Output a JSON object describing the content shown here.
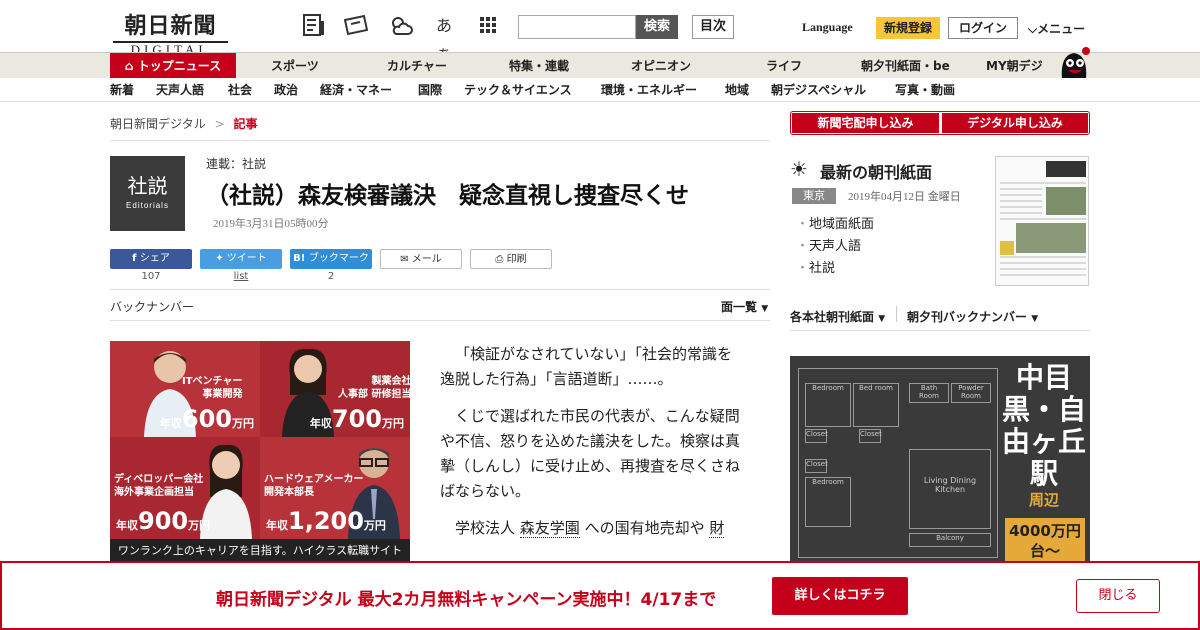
{
  "header": {
    "logo_jp": "朝日新聞",
    "logo_en": "DIGITAL",
    "font_size_icon_label": "あぁ",
    "search_button": "検索",
    "mokuji": "目次",
    "language": "Language",
    "register": "新規登録",
    "login": "ログイン",
    "menu": "メニュー"
  },
  "nav1": [
    "トップニュース",
    "スポーツ",
    "カルチャー",
    "特集・連載",
    "オピニオン",
    "ライフ",
    "朝夕刊紙面・be",
    "MY朝デジ"
  ],
  "nav2": [
    "新着",
    "天声人語",
    "社会",
    "政治",
    "経済・マネー",
    "国際",
    "テック＆サイエンス",
    "環境・エネルギー",
    "地域",
    "朝デジスペシャル",
    "写真・動画"
  ],
  "breadcrumb": {
    "home": "朝日新聞デジタル",
    "sep": ">",
    "current": "記事"
  },
  "article": {
    "category_box_jp": "社説",
    "category_box_en": "Editorials",
    "series": "連載：社説",
    "title": "（社説）森友検審議決　疑念直視し捜査尽くせ",
    "date": "2019年3月31日05時00分",
    "share": {
      "label": "シェア",
      "count": "107"
    },
    "tweet": {
      "label": "ツイート",
      "count": "list"
    },
    "bookmark": {
      "label": "ブックマーク",
      "count": "2"
    },
    "mail": "メール",
    "print": "印刷",
    "back_number": "バックナンバー",
    "ichiran": "面一覧",
    "p1": "「検証がなされていない」「社会的常識を逸脱した行為」「言語道断」……。",
    "p2": "くじで選ばれた市民の代表が、こんな疑問や不信、怒りを込めた議決をした。検察は真摯（しんし）に受け止め、再捜査を尽くさねばならない。",
    "p3_a": "学校法人",
    "p3_link": "森友学園",
    "p3_b": "への国有地売却や",
    "p3_c": "財"
  },
  "ad1": {
    "q1_title": "ITベンチャー\n事業開発",
    "q1_sal_pre": "年収",
    "q1_sal": "600",
    "q2_title": "製薬会社\n人事部 研修担当",
    "q2_sal_pre": "年収",
    "q2_sal": "700",
    "q3_title": "ディベロッパー会社\n海外事業企画担当",
    "q3_sal_pre": "年収",
    "q3_sal": "900",
    "q4_title": "ハードウェアメーカー\n開発本部長",
    "q4_sal_pre": "年収",
    "q4_sal": "1,200",
    "unit": "万円",
    "footer": "ワンランク上のキャリアを目指す。ハイクラス転職サイト"
  },
  "right": {
    "delivery": "新聞宅配申し込み",
    "digital": "デジタル申し込み",
    "latest_title": "最新の朝刊紙面",
    "region": "東京",
    "paper_date": "2019年04月12日 金曜日",
    "links": [
      "地域面紙面",
      "天声人語",
      "社説"
    ],
    "honsha": "各本社朝刊紙面",
    "yukan": "朝夕刊バックナンバー"
  },
  "ad2": {
    "rooms": [
      "Bedroom",
      "Bed room",
      "Bath Room",
      "Powder Room",
      "Closet",
      "Closet",
      "Closet",
      "Bedroom",
      "Living Dining Kitchen",
      "Balcony"
    ],
    "town": "中目黒・自由ヶ丘駅",
    "area": "周辺",
    "price": "4000万円台〜"
  },
  "banner": {
    "text": "朝日新聞デジタル 最大2カ月無料キャンペーン実施中！4/17まで",
    "more": "詳しくはコチラ",
    "close": "閉じる"
  }
}
